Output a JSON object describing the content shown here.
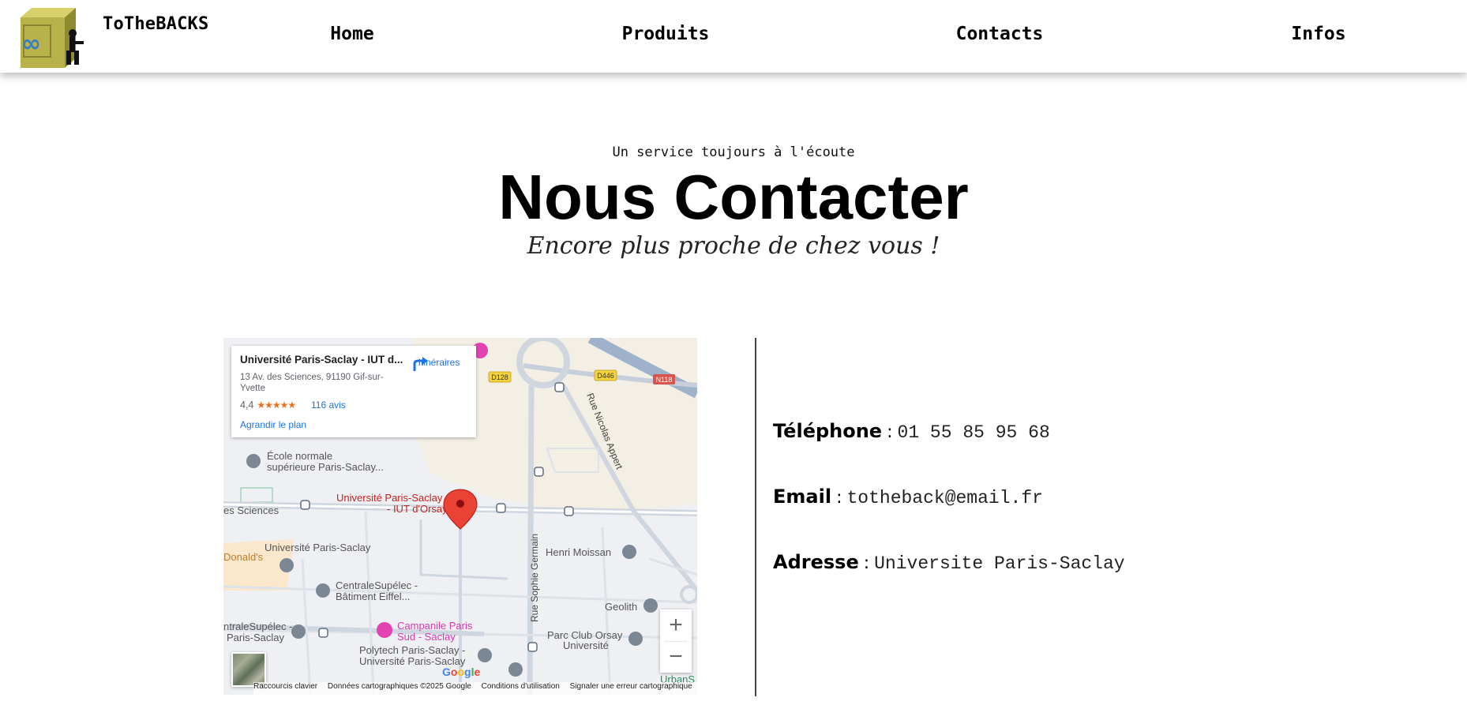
{
  "header": {
    "brand": "ToTheBACKS",
    "logo_icon": "box-mascot-logo-icon",
    "nav": [
      {
        "label": "Home"
      },
      {
        "label": "Produits"
      },
      {
        "label": "Contacts"
      },
      {
        "label": "Infos"
      }
    ]
  },
  "hero": {
    "kicker": "Un service toujours à l'écoute",
    "title": "Nous Contacter",
    "subtitle": "Encore plus proche de chez vous !"
  },
  "map": {
    "card": {
      "name": "Université Paris-Saclay - IUT d...",
      "address": "13 Av. des Sciences, 91190 Gif-sur-Yvette",
      "rating": "4,4",
      "stars": "★★★★★",
      "reviews": "116 avis",
      "enlarge": "Agrandir le plan",
      "directions": "Itinéraires"
    },
    "labels": {
      "ecole": [
        "École normale",
        "supérieure Paris-Saclay..."
      ],
      "iut": [
        "Université Paris-Saclay",
        "- IUT d'Orsay"
      ],
      "sciences": "es Sciences",
      "universite": "Université Paris-Saclay",
      "donalds": "Donald's",
      "centrale": [
        "CentraleSupélec -",
        "Bâtiment Eiffel..."
      ],
      "centrale2": [
        "ntraleSupélec -",
        "Paris-Saclay"
      ],
      "campanile": [
        "Campanile Paris",
        "Sud - Saclay"
      ],
      "polytech": [
        "Polytech Paris-Saclay -",
        "Université Paris-Saclay"
      ],
      "henri": "Henri Moissan",
      "geolith": "Geolith",
      "parc": [
        "Parc Club Orsay",
        "Université"
      ],
      "urbans": "UrbanS",
      "rue_appert": "Rue Nicolas Appert",
      "rue_germain": "Rue Sophie Germain",
      "d128": "D128",
      "d446": "D446",
      "n118": "N118"
    },
    "zoom_in": "+",
    "zoom_out": "−",
    "google": "Google",
    "attribution": {
      "shortcuts": "Raccourcis clavier",
      "data": "Données cartographiques ©2025 Google",
      "terms": "Conditions d'utilisation",
      "report": "Signaler une erreur cartographique"
    }
  },
  "contact": {
    "phone_label": "Téléphone",
    "phone": "01 55 85 95 68",
    "email_label": "Email",
    "email": "totheback@email.fr",
    "address_label": "Adresse",
    "address": "Universite Paris-Saclay",
    "separator": ":"
  }
}
